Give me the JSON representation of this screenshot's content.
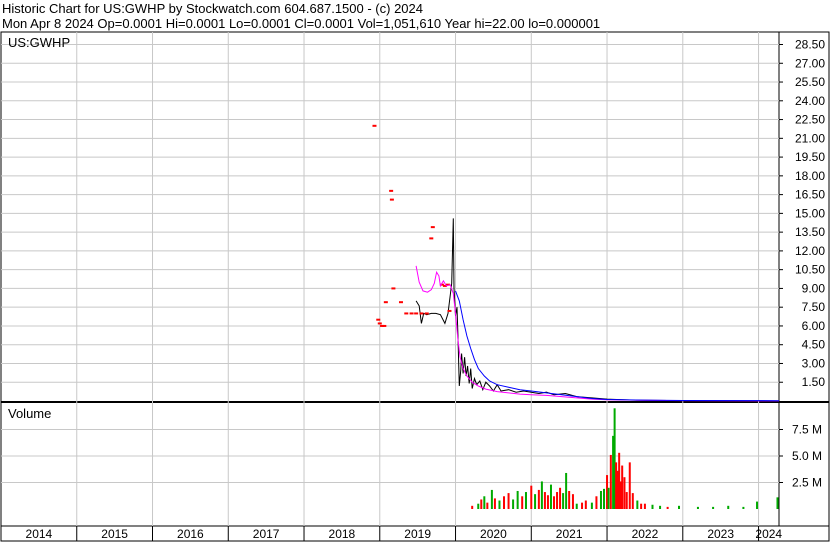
{
  "header": {
    "line1": "Historic Chart for US:GWHP by Stockwatch.com 604.687.1500 - (c) 2024",
    "line2": "Mon Apr  8 2024   Op=0.0001   Hi=0.0001   Lo=0.0001   Cl=0.0001   Vol=1,051,610   Year hi=22.00   lo=0.000001"
  },
  "chart_data": [
    {
      "type": "line",
      "symbol_label": "US:GWHP",
      "y_ticks": [
        "28.50",
        "27.00",
        "25.50",
        "24.00",
        "22.50",
        "21.00",
        "19.50",
        "18.00",
        "16.50",
        "15.00",
        "13.50",
        "12.00",
        "10.50",
        "9.00",
        "7.50",
        "6.00",
        "4.50",
        "3.00",
        "1.50"
      ],
      "ylim": [
        0,
        29.5
      ],
      "x_years": [
        "2014",
        "2015",
        "2016",
        "2017",
        "2018",
        "2019",
        "2020",
        "2021",
        "2022",
        "2023",
        "2024"
      ],
      "series": [
        {
          "kind": "price",
          "color": "#000000",
          "points": [
            [
              2019.48,
              8.0
            ],
            [
              2019.52,
              7.6
            ],
            [
              2019.55,
              6.2
            ],
            [
              2019.58,
              7.0
            ],
            [
              2019.62,
              6.9
            ],
            [
              2019.68,
              7.0
            ],
            [
              2019.74,
              7.0
            ],
            [
              2019.8,
              6.9
            ],
            [
              2019.86,
              6.2
            ],
            [
              2019.9,
              7.0
            ],
            [
              2019.95,
              9.4
            ],
            [
              2019.97,
              14.6
            ],
            [
              2019.98,
              9.0
            ],
            [
              2020.0,
              6.8
            ],
            [
              2020.02,
              7.5
            ],
            [
              2020.03,
              5.6
            ],
            [
              2020.05,
              1.2
            ],
            [
              2020.07,
              2.5
            ],
            [
              2020.08,
              3.8
            ],
            [
              2020.1,
              2.2
            ],
            [
              2020.12,
              3.5
            ],
            [
              2020.14,
              2.0
            ],
            [
              2020.16,
              2.8
            ],
            [
              2020.18,
              1.4
            ],
            [
              2020.2,
              2.6
            ],
            [
              2020.22,
              1.0
            ],
            [
              2020.25,
              1.8
            ],
            [
              2020.28,
              1.3
            ],
            [
              2020.32,
              1.6
            ],
            [
              2020.36,
              0.9
            ],
            [
              2020.4,
              1.5
            ],
            [
              2020.45,
              1.2
            ],
            [
              2020.5,
              0.8
            ],
            [
              2020.55,
              1.3
            ],
            [
              2020.6,
              0.8
            ],
            [
              2020.7,
              0.9
            ],
            [
              2020.8,
              0.7
            ],
            [
              2020.9,
              0.8
            ],
            [
              2021.0,
              0.7
            ],
            [
              2021.1,
              0.6
            ],
            [
              2021.2,
              0.7
            ],
            [
              2021.3,
              0.5
            ],
            [
              2021.45,
              0.6
            ],
            [
              2021.6,
              0.35
            ],
            [
              2021.8,
              0.25
            ],
            [
              2022.0,
              0.15
            ],
            [
              2022.3,
              0.08
            ],
            [
              2022.6,
              0.05
            ],
            [
              2023.0,
              0.03
            ],
            [
              2023.5,
              0.02
            ],
            [
              2024.0,
              0.01
            ],
            [
              2024.27,
              0.0001
            ]
          ]
        },
        {
          "kind": "price_red_ticks",
          "color": "#ff0000",
          "points": [
            [
              2018.93,
              22.0
            ],
            [
              2019.15,
              16.8
            ],
            [
              2019.16,
              16.1
            ],
            [
              2018.98,
              6.5
            ],
            [
              2019.0,
              6.2
            ],
            [
              2019.03,
              6.0
            ],
            [
              2019.06,
              6.0
            ],
            [
              2019.08,
              7.9
            ],
            [
              2019.18,
              9.0
            ],
            [
              2019.28,
              7.9
            ],
            [
              2019.35,
              7.0
            ],
            [
              2019.42,
              7.0
            ],
            [
              2019.48,
              7.0
            ],
            [
              2019.55,
              7.0
            ],
            [
              2019.62,
              7.0
            ],
            [
              2019.68,
              13.0
            ],
            [
              2019.7,
              13.9
            ],
            [
              2019.82,
              9.3
            ],
            [
              2019.86,
              9.2
            ],
            [
              2019.9,
              9.3
            ],
            [
              2019.92,
              7.2
            ]
          ]
        },
        {
          "kind": "ma_pink",
          "color": "#ff00ff",
          "points": [
            [
              2019.48,
              10.8
            ],
            [
              2019.52,
              9.5
            ],
            [
              2019.57,
              8.8
            ],
            [
              2019.63,
              8.7
            ],
            [
              2019.68,
              8.9
            ],
            [
              2019.72,
              9.4
            ],
            [
              2019.75,
              10.3
            ],
            [
              2019.78,
              10.0
            ],
            [
              2019.8,
              9.2
            ],
            [
              2019.84,
              9.6
            ],
            [
              2019.88,
              9.2
            ],
            [
              2019.93,
              9.3
            ],
            [
              2019.97,
              8.6
            ],
            [
              2020.0,
              7.0
            ],
            [
              2020.03,
              5.0
            ],
            [
              2020.06,
              3.5
            ],
            [
              2020.1,
              2.6
            ],
            [
              2020.15,
              2.0
            ],
            [
              2020.22,
              1.5
            ],
            [
              2020.3,
              1.2
            ],
            [
              2020.4,
              0.95
            ],
            [
              2020.55,
              0.75
            ],
            [
              2020.7,
              0.65
            ],
            [
              2020.85,
              0.55
            ],
            [
              2021.0,
              0.5
            ],
            [
              2021.2,
              0.45
            ],
            [
              2021.4,
              0.35
            ],
            [
              2021.6,
              0.25
            ],
            [
              2021.8,
              0.15
            ],
            [
              2022.0,
              0.1
            ],
            [
              2022.4,
              0.06
            ],
            [
              2023.0,
              0.03
            ],
            [
              2024.27,
              0.01
            ]
          ]
        },
        {
          "kind": "ma_blue",
          "color": "#0000ff",
          "points": [
            [
              2020.0,
              8.8
            ],
            [
              2020.05,
              8.0
            ],
            [
              2020.1,
              6.5
            ],
            [
              2020.15,
              5.2
            ],
            [
              2020.2,
              4.2
            ],
            [
              2020.25,
              3.3
            ],
            [
              2020.3,
              2.6
            ],
            [
              2020.38,
              2.0
            ],
            [
              2020.45,
              1.6
            ],
            [
              2020.55,
              1.3
            ],
            [
              2020.7,
              1.1
            ],
            [
              2020.85,
              0.9
            ],
            [
              2021.0,
              0.8
            ],
            [
              2021.2,
              0.65
            ],
            [
              2021.4,
              0.5
            ],
            [
              2021.6,
              0.35
            ],
            [
              2021.8,
              0.2
            ],
            [
              2022.0,
              0.12
            ],
            [
              2022.5,
              0.07
            ],
            [
              2023.0,
              0.04
            ],
            [
              2024.27,
              0.02
            ]
          ]
        }
      ]
    },
    {
      "type": "bar",
      "panel_label": "Volume",
      "y_ticks": [
        "7.5 M",
        "5.0 M",
        "2.5 M"
      ],
      "ylim": [
        0,
        10.0
      ],
      "unit": "M",
      "bars": [
        [
          2020.22,
          0.3,
          "#ff0000"
        ],
        [
          2020.3,
          0.5,
          "#00aa00"
        ],
        [
          2020.34,
          0.9,
          "#ff0000"
        ],
        [
          2020.38,
          1.2,
          "#00aa00"
        ],
        [
          2020.42,
          0.6,
          "#ff0000"
        ],
        [
          2020.48,
          1.8,
          "#00aa00"
        ],
        [
          2020.52,
          1.0,
          "#ff0000"
        ],
        [
          2020.58,
          0.8,
          "#00aa00"
        ],
        [
          2020.64,
          1.2,
          "#ff0000"
        ],
        [
          2020.7,
          1.5,
          "#ff0000"
        ],
        [
          2020.76,
          0.9,
          "#00aa00"
        ],
        [
          2020.82,
          1.7,
          "#00aa00"
        ],
        [
          2020.88,
          1.2,
          "#ff0000"
        ],
        [
          2020.93,
          1.6,
          "#00aa00"
        ],
        [
          2021.0,
          2.2,
          "#ff0000"
        ],
        [
          2021.05,
          1.4,
          "#00aa00"
        ],
        [
          2021.1,
          1.8,
          "#ff0000"
        ],
        [
          2021.14,
          2.6,
          "#00aa00"
        ],
        [
          2021.18,
          1.6,
          "#ff0000"
        ],
        [
          2021.22,
          1.3,
          "#ff0000"
        ],
        [
          2021.26,
          2.3,
          "#00aa00"
        ],
        [
          2021.3,
          1.2,
          "#ff0000"
        ],
        [
          2021.34,
          1.6,
          "#ff0000"
        ],
        [
          2021.38,
          2.0,
          "#ff0000"
        ],
        [
          2021.42,
          1.5,
          "#00aa00"
        ],
        [
          2021.46,
          3.4,
          "#00aa00"
        ],
        [
          2021.5,
          1.7,
          "#ff0000"
        ],
        [
          2021.55,
          1.4,
          "#ff0000"
        ],
        [
          2021.6,
          0.5,
          "#00aa00"
        ],
        [
          2021.67,
          0.6,
          "#ff0000"
        ],
        [
          2021.72,
          0.8,
          "#ff0000"
        ],
        [
          2021.8,
          0.6,
          "#00aa00"
        ],
        [
          2021.86,
          1.2,
          "#ff0000"
        ],
        [
          2021.92,
          1.7,
          "#00aa00"
        ],
        [
          2021.96,
          1.9,
          "#00aa00"
        ],
        [
          2022.0,
          3.2,
          "#ff0000"
        ],
        [
          2022.02,
          2.0,
          "#00aa00"
        ],
        [
          2022.05,
          5.1,
          "#ff0000"
        ],
        [
          2022.08,
          6.9,
          "#00aa00"
        ],
        [
          2022.1,
          9.5,
          "#00aa00"
        ],
        [
          2022.12,
          4.4,
          "#ff0000"
        ],
        [
          2022.14,
          3.6,
          "#ff0000"
        ],
        [
          2022.16,
          5.3,
          "#ff0000"
        ],
        [
          2022.18,
          2.6,
          "#ff0000"
        ],
        [
          2022.2,
          4.1,
          "#ff0000"
        ],
        [
          2022.23,
          3.0,
          "#ff0000"
        ],
        [
          2022.26,
          1.6,
          "#ff0000"
        ],
        [
          2022.3,
          4.4,
          "#ff0000"
        ],
        [
          2022.34,
          1.5,
          "#ff0000"
        ],
        [
          2022.4,
          0.8,
          "#00aa00"
        ],
        [
          2022.45,
          0.5,
          "#ff0000"
        ],
        [
          2022.5,
          0.5,
          "#ff0000"
        ],
        [
          2022.6,
          0.4,
          "#00aa00"
        ],
        [
          2022.7,
          0.3,
          "#00aa00"
        ],
        [
          2022.8,
          0.2,
          "#ff0000"
        ],
        [
          2022.95,
          0.3,
          "#00aa00"
        ],
        [
          2023.2,
          0.2,
          "#00aa00"
        ],
        [
          2023.4,
          0.2,
          "#00aa00"
        ],
        [
          2023.6,
          0.3,
          "#00aa00"
        ],
        [
          2023.8,
          0.2,
          "#00aa00"
        ],
        [
          2023.98,
          0.7,
          "#00aa00"
        ],
        [
          2024.25,
          1.1,
          "#00aa00"
        ]
      ]
    }
  ]
}
